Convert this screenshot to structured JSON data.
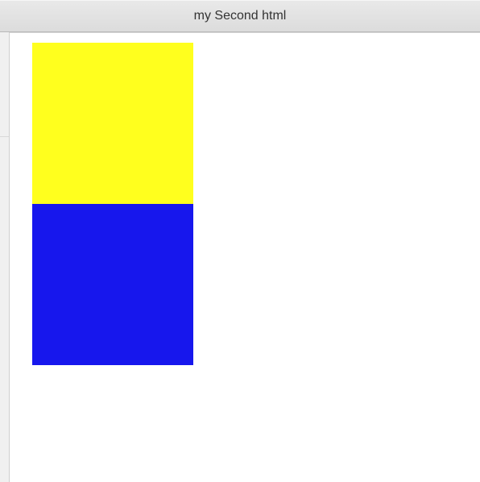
{
  "window": {
    "title": "my Second html"
  },
  "content": {
    "blocks": [
      {
        "name": "yellow-block",
        "color": "#ffff1e"
      },
      {
        "name": "blue-block",
        "color": "#1717ed"
      }
    ]
  }
}
